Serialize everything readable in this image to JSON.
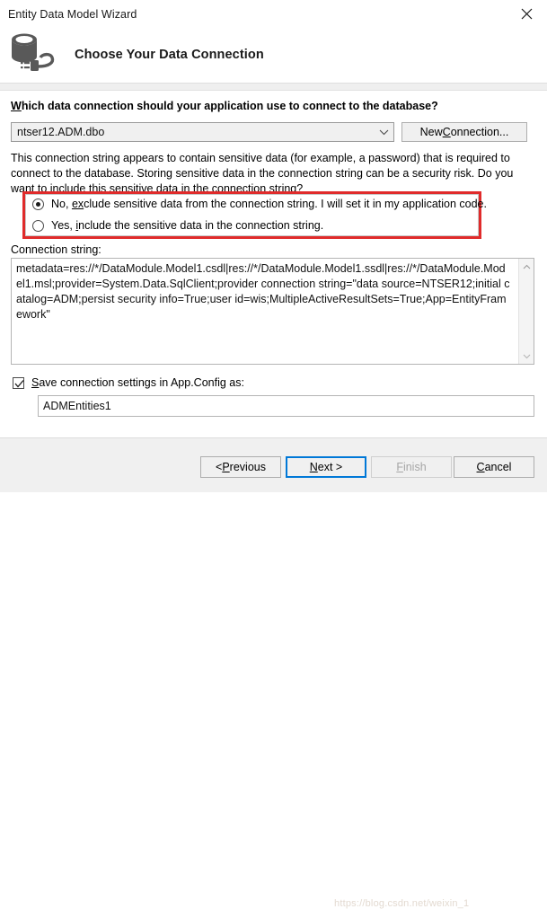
{
  "window": {
    "title": "Entity Data Model Wizard",
    "close_icon": "close-icon"
  },
  "header": {
    "icon": "database-connection-icon",
    "title": "Choose Your Data Connection"
  },
  "main": {
    "question_label_prefix": "W",
    "question_label_rest": "hich data connection should your application use to connect to the database?",
    "connection_combo": {
      "value": "ntser12.ADM.dbo",
      "arrow_icon": "chevron-down-icon"
    },
    "new_connection_button": {
      "prefix": "New ",
      "accel": "C",
      "suffix": "onnection..."
    },
    "sensitive_note": "This connection string appears to contain sensitive data (for example, a password) that is required to connect to the database. Storing sensitive data in the connection string can be a security risk. Do you want to include this sensitive data in the connection string?",
    "radio_options": [
      {
        "prefix": "No, ",
        "accel": "ex",
        "suffix": "clude sensitive data from the connection string. I will set it in my application code.",
        "selected": true
      },
      {
        "prefix": "Yes, ",
        "accel": "i",
        "suffix": "nclude the sensitive data in the connection string.",
        "selected": false
      }
    ],
    "connection_string_label": "Connection string:",
    "connection_string_value": "metadata=res://*/DataModule.Model1.csdl|res://*/DataModule.Model1.ssdl|res://*/DataModule.Model1.msl;provider=System.Data.SqlClient;provider connection string=\"data source=NTSER12;initial catalog=ADM;persist security info=True;user id=wis;MultipleActiveResultSets=True;App=EntityFramework\"",
    "scrollbar": {
      "up_icon": "chevron-up-icon",
      "down_icon": "chevron-down-icon"
    },
    "save_checkbox": {
      "checked": true,
      "prefix": "",
      "accel": "S",
      "suffix": "ave connection settings in App.Config as:",
      "check_icon": "checkmark-icon"
    },
    "appconfig_name": "ADMEntities1"
  },
  "footer": {
    "previous": {
      "prefix": "< ",
      "accel": "P",
      "suffix": "revious"
    },
    "next": {
      "prefix": "",
      "accel": "N",
      "suffix": "ext >"
    },
    "finish": {
      "prefix": "",
      "accel": "F",
      "suffix": "inish"
    },
    "cancel": {
      "prefix": "",
      "accel": "C",
      "suffix": "ancel"
    },
    "watermark": "https://blog.csdn.net/weixin_1"
  },
  "colors": {
    "accent": "#0078d7",
    "annotation": "#e02b2b",
    "panel": "#f0f0f0"
  }
}
